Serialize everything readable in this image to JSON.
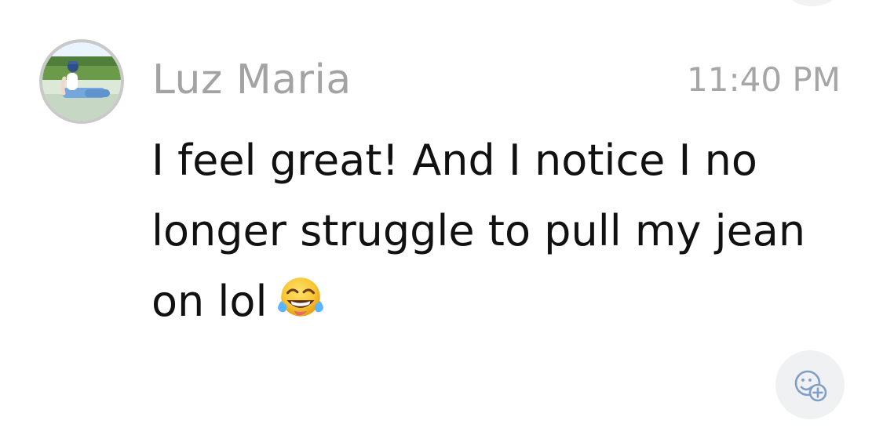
{
  "message": {
    "sender_name": "Luz Maria",
    "timestamp": "11:40 PM",
    "text": "I feel great! And I notice I no longer struggle to pull my jean on lol",
    "emoji": "face-with-tears-of-joy",
    "avatar": "profile-photo"
  },
  "actions": {
    "add_reaction_icon": "add-reaction-icon"
  },
  "colors": {
    "background": "#ffffff",
    "sender_name": "#a3a3a3",
    "timestamp": "#a6a6a6",
    "message_text": "#111111",
    "avatar_ring": "#c9c9c9",
    "reaction_button_bg": "#f0f1f2",
    "reaction_icon": "#7f9ec9"
  }
}
